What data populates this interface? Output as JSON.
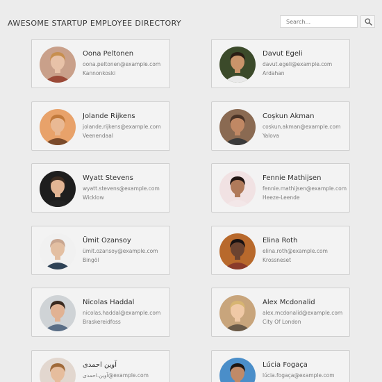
{
  "header": {
    "title": "AWESOME STARTUP EMPLOYEE DIRECTORY",
    "search_placeholder": "Search...",
    "search_icon": "magnifier-icon"
  },
  "employees": [
    {
      "name": "Oona Peltonen",
      "email": "oona.peltonen@example.com",
      "city": "Kannonkoski",
      "avatar": {
        "bg": "#c9a08a",
        "skin": "#e8c2a8",
        "hair": "#c78f4f",
        "shirt": "#9b4a38"
      }
    },
    {
      "name": "Davut Egeli",
      "email": "davut.egeli@example.com",
      "city": "Ardahan",
      "avatar": {
        "bg": "#3b4a2a",
        "skin": "#c9946a",
        "hair": "#2a1d14",
        "shirt": "#e9e9e9"
      }
    },
    {
      "name": "Jolande Rijkens",
      "email": "jolande.rijkens@example.com",
      "city": "Veenendaal",
      "avatar": {
        "bg": "#e8a26a",
        "skin": "#e9b994",
        "hair": "#c27a3c",
        "shirt": "#7a4a2a"
      }
    },
    {
      "name": "Coşkun Akman",
      "email": "coskun.akman@example.com",
      "city": "Yalova",
      "avatar": {
        "bg": "#8a6a52",
        "skin": "#c08864",
        "hair": "#4a3326",
        "shirt": "#3a3a3a"
      }
    },
    {
      "name": "Wyatt Stevens",
      "email": "wyatt.stevens@example.com",
      "city": "Wicklow",
      "avatar": {
        "bg": "#1e1e1e",
        "skin": "#e2b594",
        "hair": "#3a2a20",
        "shirt": "#222222"
      }
    },
    {
      "name": "Fennie Mathijsen",
      "email": "fennie.mathijsen@example.com",
      "city": "Heeze-Leende",
      "avatar": {
        "bg": "#f1e2e3",
        "skin": "#b07a5a",
        "hair": "#1f1411",
        "shirt": "#f3e7e8"
      }
    },
    {
      "name": "Ümit Ozansoy",
      "email": "ümit.ozansoy@example.com",
      "city": "Bingöl",
      "avatar": {
        "bg": "#f1f1f1",
        "skin": "#e3bfa2",
        "hair": "#c9a690",
        "shirt": "#2e4256"
      }
    },
    {
      "name": "Elina Roth",
      "email": "elina.roth@example.com",
      "city": "Krossneset",
      "avatar": {
        "bg": "#b8692c",
        "skin": "#6b4330",
        "hair": "#181212",
        "shirt": "#8a3a2a"
      }
    },
    {
      "name": "Nicolas Haddal",
      "email": "nicolas.haddal@example.com",
      "city": "Braskereidfoss",
      "avatar": {
        "bg": "#cfd3d6",
        "skin": "#e1b293",
        "hair": "#3a2a20",
        "shirt": "#5a6e86"
      }
    },
    {
      "name": "Alex Mcdonalid",
      "email": "alex.mcdonalid@example.com",
      "city": "City Of London",
      "avatar": {
        "bg": "#c8a57c",
        "skin": "#f0c9a6",
        "hair": "#d7b572",
        "shirt": "#6a5a48"
      }
    },
    {
      "name": "آوین احمدی",
      "email": "آوین.احمدی@example.com",
      "city": "",
      "avatar": {
        "bg": "#e2d7cf",
        "skin": "#e6bd9d",
        "hair": "#a06a3a",
        "shirt": "#e7dcd4"
      }
    },
    {
      "name": "Lúcia Fogaça",
      "email": "lúcia.fogaça@example.com",
      "city": "",
      "avatar": {
        "bg": "#4a8ec9",
        "skin": "#c08a68",
        "hair": "#1e1612",
        "shirt": "#3b6b9a"
      }
    }
  ]
}
